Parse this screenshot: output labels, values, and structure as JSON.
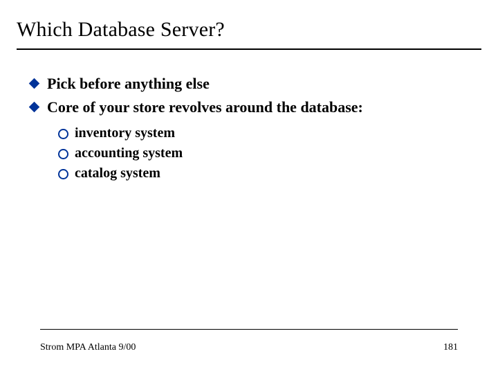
{
  "title": "Which Database Server?",
  "bullets": [
    "Pick before anything else",
    "Core of your store revolves around the database:"
  ],
  "subbullets": [
    "inventory system",
    "accounting system",
    "catalog system"
  ],
  "footer": {
    "left": "Strom MPA Atlanta 9/00",
    "page": "181"
  }
}
